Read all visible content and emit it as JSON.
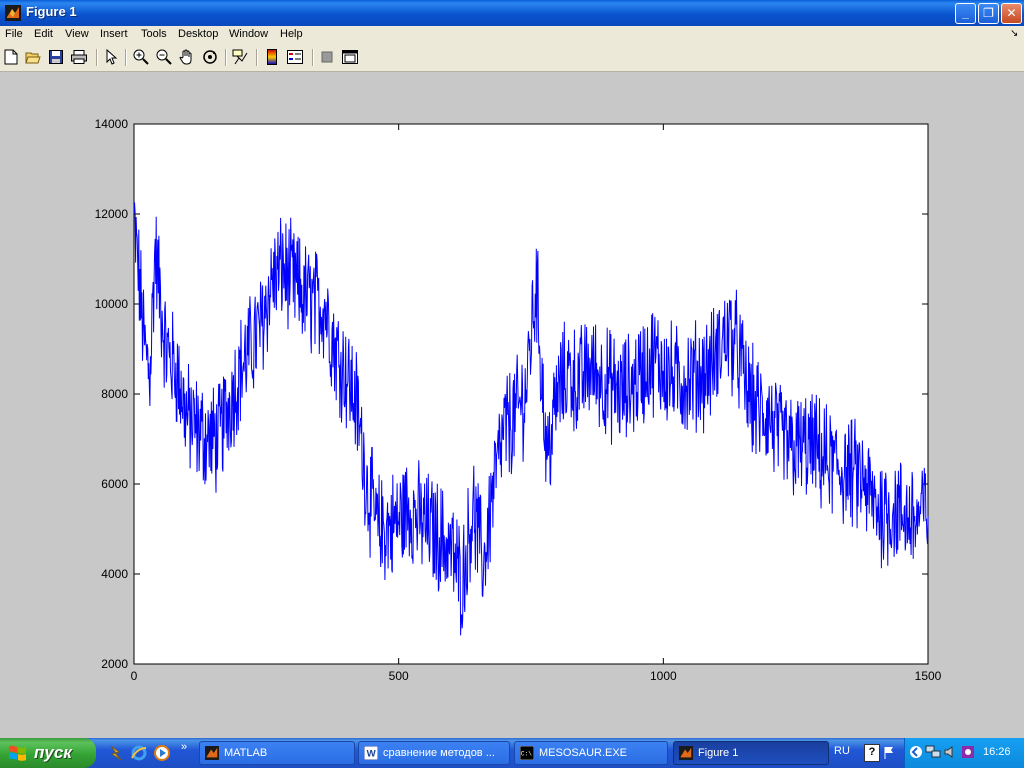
{
  "window": {
    "title": "Figure 1"
  },
  "menu": [
    "File",
    "Edit",
    "View",
    "Insert",
    "Tools",
    "Desktop",
    "Window",
    "Help"
  ],
  "toolbar_icons": [
    "new-file-icon",
    "open-folder-icon",
    "save-icon",
    "print-icon",
    "pointer-icon",
    "zoom-in-icon",
    "zoom-out-icon",
    "pan-hand-icon",
    "rotate-3d-icon",
    "data-cursor-icon",
    "colorbar-icon",
    "legend-icon",
    "hide-plot-tools-icon",
    "show-plot-tools-icon"
  ],
  "chart_data": {
    "type": "line",
    "title": "",
    "xlabel": "",
    "ylabel": "",
    "xlim": [
      0,
      1500
    ],
    "ylim": [
      2000,
      14000
    ],
    "xticks": [
      "0",
      "500",
      "1000",
      "1500"
    ],
    "yticks": [
      "2000",
      "4000",
      "6000",
      "8000",
      "10000",
      "12000",
      "14000"
    ],
    "grid": false,
    "series_color": "#0000ff",
    "series": [
      {
        "x": [
          0,
          10,
          20,
          30,
          40,
          60,
          80,
          100,
          120,
          140,
          160,
          180,
          200,
          220,
          240,
          260,
          280,
          300,
          320,
          340,
          360,
          380,
          400,
          420,
          440,
          460,
          480,
          500,
          520,
          540,
          560,
          580,
          600,
          620,
          640,
          660,
          680,
          700,
          720,
          740,
          760,
          780,
          800,
          820,
          840,
          860,
          880,
          900,
          920,
          940,
          960,
          980,
          1000,
          1020,
          1040,
          1060,
          1080,
          1100,
          1120,
          1140,
          1160,
          1180,
          1200,
          1220,
          1240,
          1260,
          1280,
          1300,
          1320,
          1340,
          1360,
          1380,
          1400,
          1420,
          1440,
          1460,
          1480,
          1500
        ],
        "values": [
          11800,
          10500,
          9000,
          8500,
          11200,
          9000,
          8500,
          7500,
          7200,
          7000,
          7000,
          7800,
          8500,
          9000,
          9500,
          10500,
          10800,
          10500,
          10200,
          10000,
          10000,
          9000,
          8500,
          7800,
          6000,
          5000,
          5000,
          5200,
          5500,
          5200,
          5000,
          4800,
          4500,
          3800,
          5500,
          4200,
          6000,
          7200,
          7500,
          8000,
          10500,
          6500,
          8000,
          8500,
          8200,
          8600,
          8400,
          8200,
          8000,
          8200,
          8500,
          8800,
          8600,
          8300,
          8300,
          8400,
          8500,
          8800,
          9400,
          9000,
          8000,
          7600,
          7500,
          7000,
          6800,
          6800,
          6800,
          6600,
          6400,
          6300,
          6200,
          6000,
          5500,
          5400,
          5400,
          5300,
          5200,
          5500
        ]
      }
    ]
  },
  "taskbar": {
    "start_label": "пуск",
    "tasks": [
      {
        "label": "MATLAB",
        "active": false
      },
      {
        "label": "сравнение методов ...",
        "active": false
      },
      {
        "label": "MESOSAUR.EXE",
        "active": false
      },
      {
        "label": "Figure 1",
        "active": true
      }
    ],
    "language": "RU",
    "clock": "16:26"
  }
}
